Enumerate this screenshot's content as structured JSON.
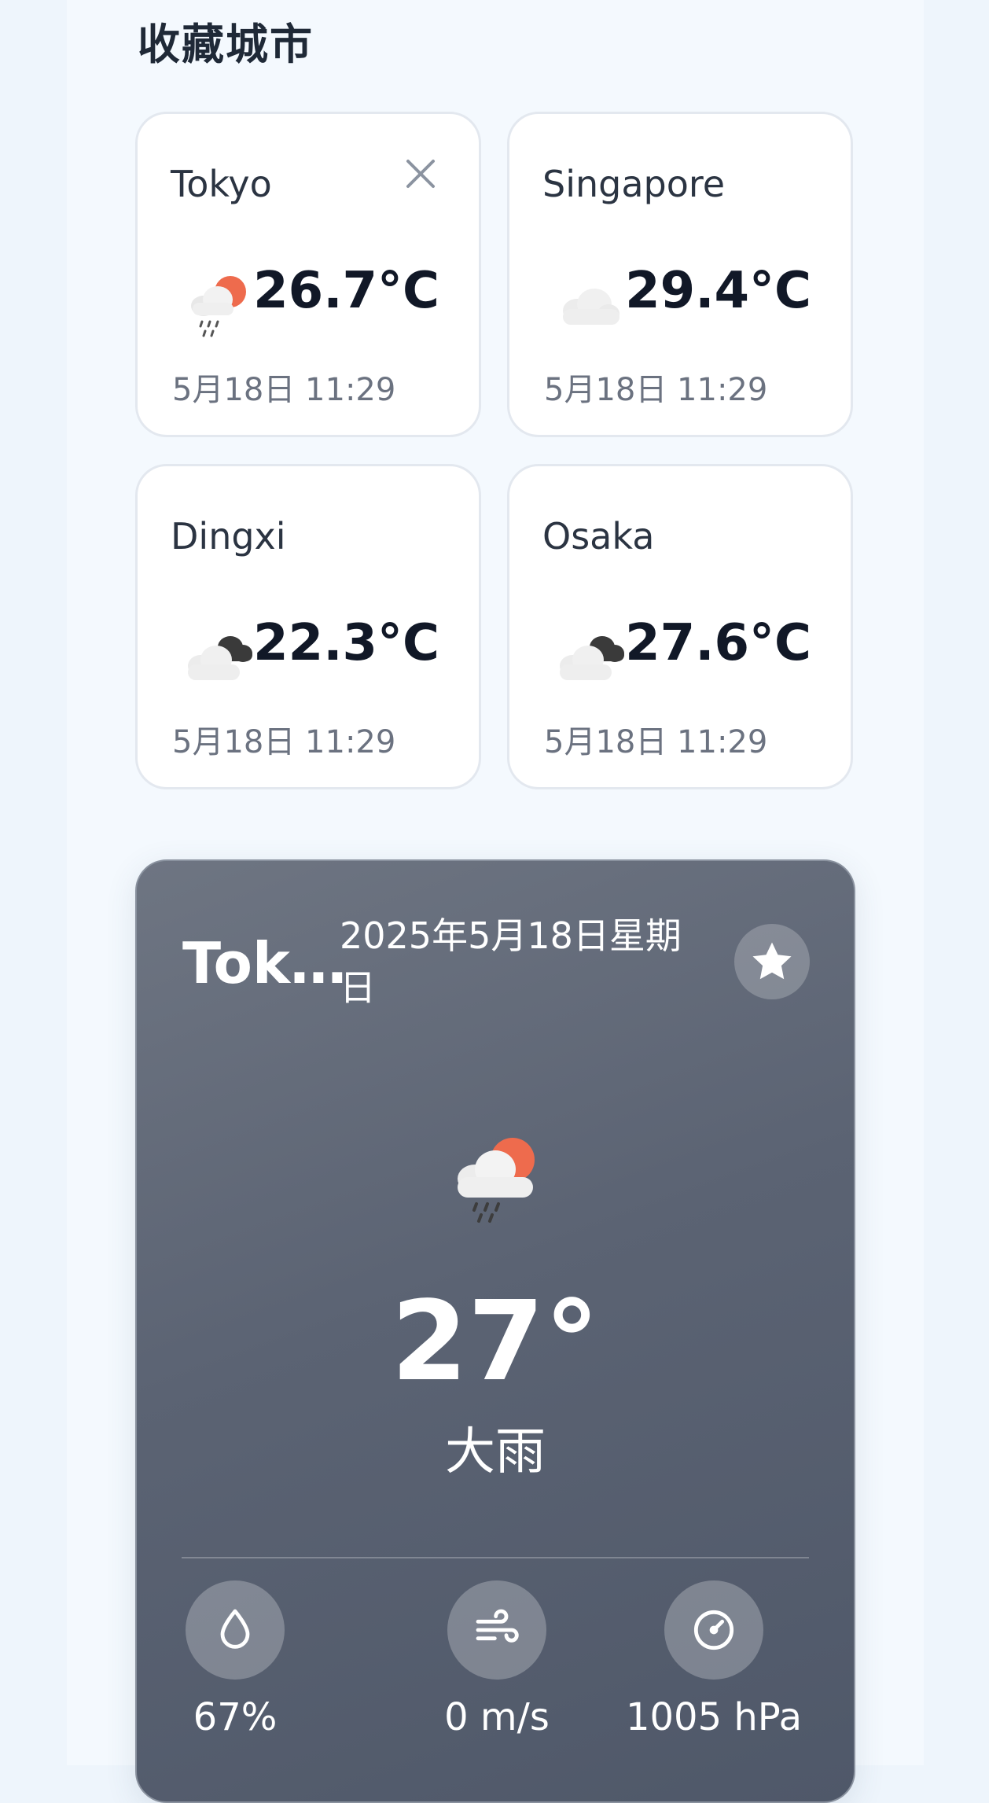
{
  "favorites": {
    "title": "收藏城市",
    "cards": [
      {
        "city": "Tokyo",
        "temp": "26.7°C",
        "time": "5月18日 11:29",
        "icon": "rain-sun-icon",
        "removable": true
      },
      {
        "city": "Singapore",
        "temp": "29.4°C",
        "time": "5月18日 11:29",
        "icon": "cloud-icon",
        "removable": false
      },
      {
        "city": "Dingxi",
        "temp": "22.3°C",
        "time": "5月18日 11:29",
        "icon": "cloud-dark-cloud-icon",
        "removable": false
      },
      {
        "city": "Osaka",
        "temp": "27.6°C",
        "time": "5月18日 11:29",
        "icon": "cloud-dark-cloud-icon",
        "removable": false
      }
    ]
  },
  "current": {
    "city": "Tok…",
    "date": "2025年5月18日星期日",
    "temperature": "27°",
    "condition": "大雨",
    "humidity": "67%",
    "wind": "0 m/s",
    "pressure": "1005 hPa"
  },
  "colors": {
    "card_gradient_start": "#6e7582",
    "card_gradient_end": "#4f5869",
    "sun": "#ee6b4d"
  }
}
